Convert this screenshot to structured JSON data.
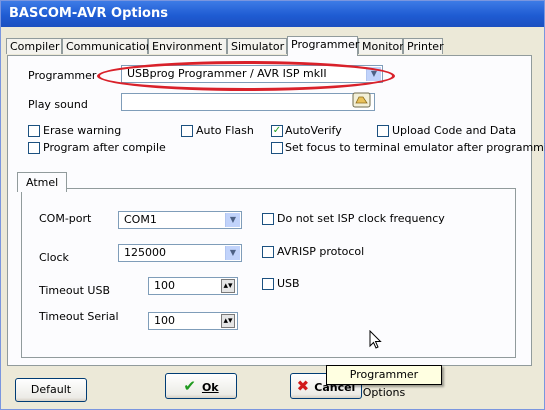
{
  "window": {
    "title": "BASCOM-AVR Options"
  },
  "tabs": [
    "Compiler",
    "Communication",
    "Environment",
    "Simulator",
    "Programmer",
    "Monitor",
    "Printer"
  ],
  "active_tab": "Programmer",
  "programmer": {
    "label": "Programmer",
    "value": "USBprog Programmer / AVR ISP mkII"
  },
  "play_sound": {
    "label": "Play sound",
    "value": ""
  },
  "checkboxes": {
    "erase_warning": {
      "label": "Erase warning",
      "checked": false
    },
    "auto_flash": {
      "label": "Auto Flash",
      "checked": false
    },
    "auto_verify": {
      "label": "AutoVerify",
      "checked": true
    },
    "upload_code": {
      "label": "Upload Code and Data",
      "checked": false
    },
    "program_after_compile": {
      "label": "Program after compile",
      "checked": false
    },
    "set_focus": {
      "label": "Set focus to terminal emulator after programming",
      "checked": false
    }
  },
  "atmel": {
    "tab_label": "Atmel",
    "com_port": {
      "label": "COM-port",
      "value": "COM1"
    },
    "clock": {
      "label": "Clock",
      "value": "125000"
    },
    "timeout_usb": {
      "label": "Timeout USB",
      "value": "100"
    },
    "timeout_serial": {
      "label": "Timeout Serial",
      "value": "100"
    },
    "no_isp_clock": {
      "label": "Do not set ISP clock frequency",
      "checked": false
    },
    "avrisp": {
      "label": "AVRISP protocol",
      "checked": false
    },
    "usb": {
      "label": "USB",
      "checked": false
    }
  },
  "buttons": {
    "default": "Default",
    "ok": "Ok",
    "cancel": "Cancel"
  },
  "tooltip": "Programmer Options",
  "colors": {
    "title_bar": "#1f5cd3",
    "highlight_oval": "#d9212a",
    "ok_check": "#1f9a1f",
    "cancel_x": "#d11a1a"
  }
}
